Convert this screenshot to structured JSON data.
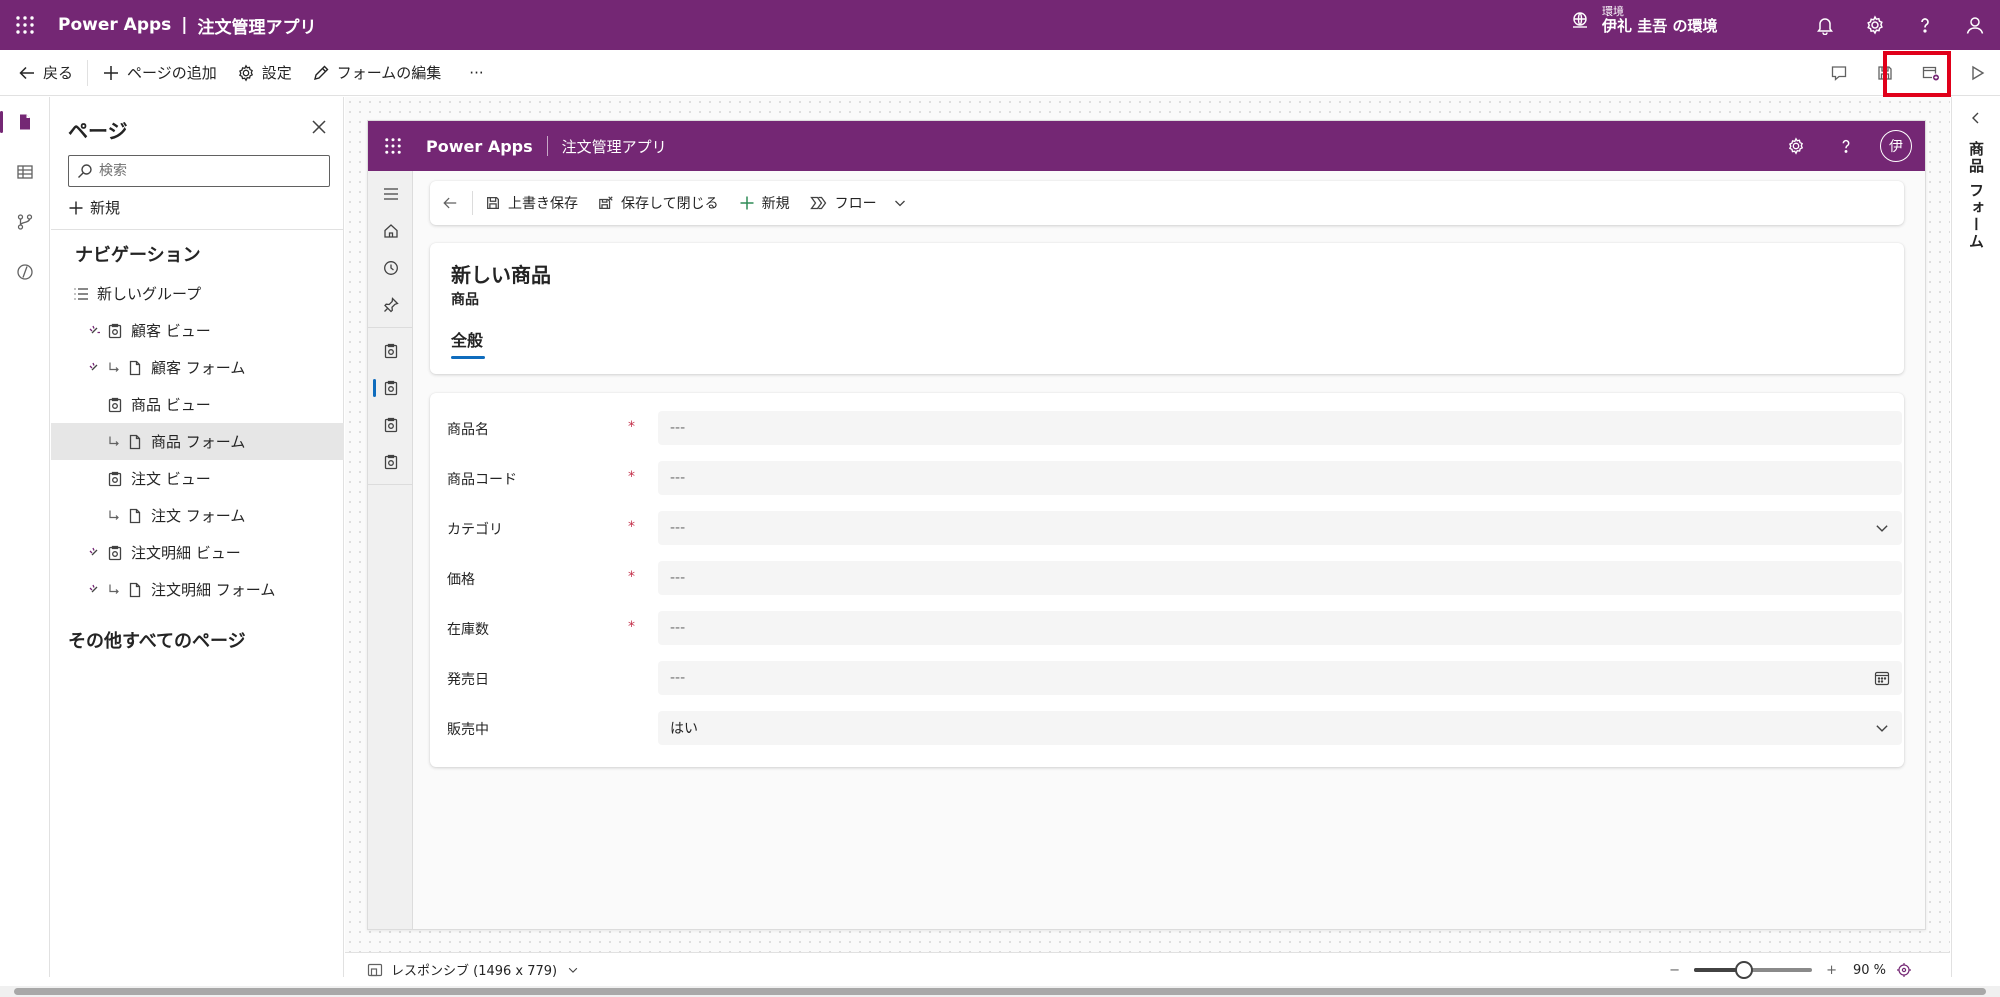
{
  "topbar": {
    "brand": "Power Apps",
    "separator": "|",
    "app_name": "注文管理アプリ",
    "environment_label": "環境",
    "environment_name": "伊礼 圭吾 の環境"
  },
  "commandbar": {
    "back": "戻る",
    "add_page": "ページの追加",
    "settings": "設定",
    "edit_form": "フォームの編集",
    "more": "···"
  },
  "pages_panel": {
    "title": "ページ",
    "search_placeholder": "検索",
    "new": "新規",
    "navigation_title": "ナビゲーション",
    "items": [
      {
        "label": "新しいグループ"
      },
      {
        "label": "顧客 ビュー"
      },
      {
        "label": "顧客 フォーム"
      },
      {
        "label": "商品 ビュー"
      },
      {
        "label": "商品 フォーム"
      },
      {
        "label": "注文 ビュー"
      },
      {
        "label": "注文 フォーム"
      },
      {
        "label": "注文明細 ビュー"
      },
      {
        "label": "注文明細 フォーム"
      }
    ],
    "other_pages_title": "その他すべてのページ"
  },
  "preview": {
    "brand": "Power Apps",
    "app_name": "注文管理アプリ",
    "avatar": "伊",
    "form_commands": {
      "save": "上書き保存",
      "save_close": "保存して閉じる",
      "new": "新規",
      "flow": "フロー"
    },
    "record": {
      "title": "新しい商品",
      "entity": "商品",
      "tab": "全般"
    },
    "fields": [
      {
        "label": "商品名",
        "required": "*",
        "value": "---"
      },
      {
        "label": "商品コード",
        "required": "*",
        "value": "---"
      },
      {
        "label": "カテゴリ",
        "required": "*",
        "value": "---"
      },
      {
        "label": "価格",
        "required": "*",
        "value": "---"
      },
      {
        "label": "在庫数",
        "required": "*",
        "value": "---"
      },
      {
        "label": "発売日",
        "required": "",
        "value": "---"
      },
      {
        "label": "販売中",
        "required": "",
        "value": "はい"
      }
    ]
  },
  "properties_panel": {
    "title": "商品 フォーム"
  },
  "statusbar": {
    "layout": "レスポンシブ (1496 x 779)",
    "zoom_minus": "−",
    "zoom_plus": "+",
    "zoom_value": "90 %",
    "zoom_percent": 90
  },
  "colors": {
    "brand": "#742774",
    "accent": "#0f6cbd",
    "required": "#c4314b",
    "highlight": "#e0001a"
  }
}
